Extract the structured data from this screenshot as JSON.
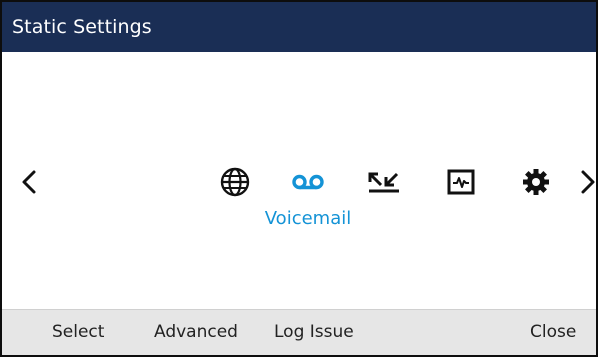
{
  "window": {
    "title": "Static Settings"
  },
  "carousel": {
    "selected_label": "Voicemail",
    "icons": [
      {
        "name": "globe-icon",
        "selected": false
      },
      {
        "name": "voicemail-icon",
        "selected": true
      },
      {
        "name": "call-log-icon",
        "selected": false
      },
      {
        "name": "diagnostics-icon",
        "selected": false
      },
      {
        "name": "gear-icon",
        "selected": false
      }
    ],
    "nav": {
      "left": "chevron-left-icon",
      "right": "chevron-right-icon"
    }
  },
  "softkeys": {
    "select": "Select",
    "advanced": "Advanced",
    "log_issue": "Log Issue",
    "close": "Close"
  },
  "colors": {
    "title_bar": "#1a2e55",
    "accent": "#1493d6",
    "softkey_bar": "#e6e6e6",
    "icon": "#111111"
  }
}
